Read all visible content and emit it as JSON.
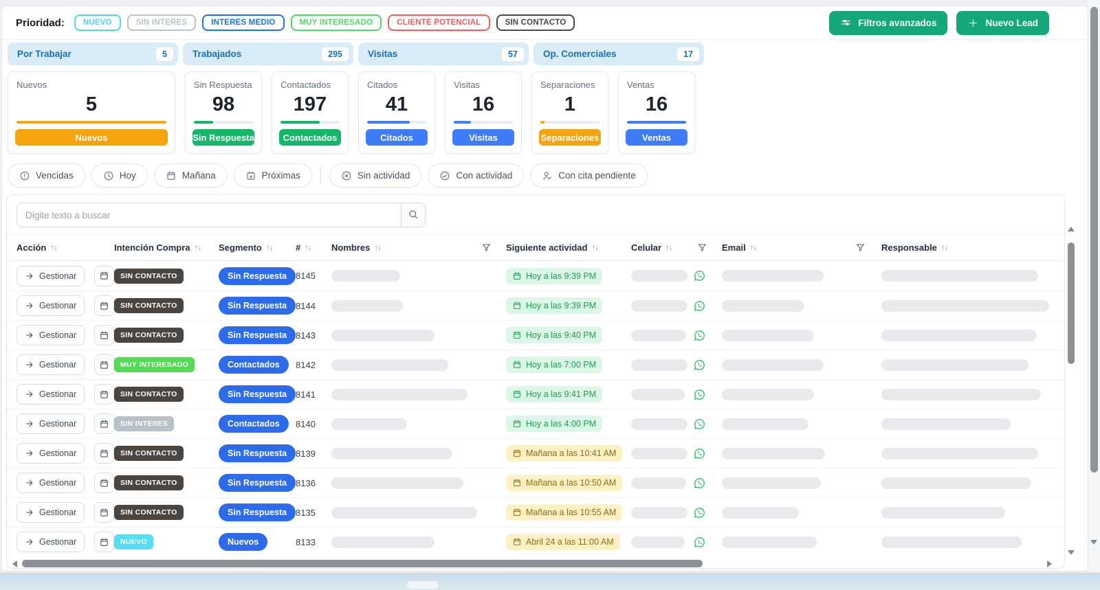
{
  "priority_bar": {
    "label": "Prioridad:",
    "badges": [
      {
        "label": "NUEVO",
        "color": "#4fd6ea"
      },
      {
        "label": "SIN INTERES",
        "color": "#b9c2cc"
      },
      {
        "label": "INTERES MEDIO",
        "color": "#1a73e8"
      },
      {
        "label": "MUY INTERESADO",
        "color": "#4fd964"
      },
      {
        "label": "CLIENTE POTENCIAL",
        "color": "#f45b5b"
      },
      {
        "label": "SIN CONTACTO",
        "color": "#43484d"
      }
    ]
  },
  "actions": {
    "advanced_filters": "Filtros avanzados",
    "new_lead": "Nuevo Lead"
  },
  "tabs": [
    {
      "label": "Por Trabajar",
      "count": "5"
    },
    {
      "label": "Trabajados",
      "count": "295"
    },
    {
      "label": "Visitas",
      "count": "57"
    },
    {
      "label": "Op. Comerciales",
      "count": "17"
    }
  ],
  "cards": [
    {
      "title": "Nuevos",
      "value": "5",
      "button": "Nuevos",
      "color": "#f6a40e",
      "progress": "100%",
      "cls": "card-wide"
    },
    {
      "title": "Sin Respuesta",
      "value": "98",
      "button": "Sin Respuesta",
      "color": "#12b76a",
      "progress": "33%"
    },
    {
      "title": "Contactados",
      "value": "197",
      "button": "Contactados",
      "color": "#12b76a",
      "progress": "66%"
    },
    {
      "title": "Citados",
      "value": "41",
      "button": "Citados",
      "color": "#3d7bf7",
      "progress": "72%"
    },
    {
      "title": "Visitas",
      "value": "16",
      "button": "Visitas",
      "color": "#3d7bf7",
      "progress": "29%"
    },
    {
      "title": "Separaciones",
      "value": "1",
      "button": "Separaciones",
      "color": "#f6a40e",
      "progress": "7%"
    },
    {
      "title": "Ventas",
      "value": "16",
      "button": "Ventas",
      "color": "#3d7bf7",
      "progress": "100%"
    }
  ],
  "chips": [
    {
      "label": "Vencidas",
      "icon": "alert-circle"
    },
    {
      "label": "Hoy",
      "icon": "clock"
    },
    {
      "label": "Mañana",
      "icon": "calendar"
    },
    {
      "label": "Próximas",
      "icon": "calendar-plus",
      "divider": true
    },
    {
      "label": "Sin actividad",
      "icon": "x-circle"
    },
    {
      "label": "Con actividad",
      "icon": "check-circle"
    },
    {
      "label": "Con cita pendiente",
      "icon": "user-check"
    }
  ],
  "search": {
    "placeholder": "Digite texto a buscar"
  },
  "table": {
    "action_label": "Gestionar",
    "columns": [
      {
        "label": "Acción",
        "sort": true
      },
      {
        "label": "Intención Compra",
        "sort": true
      },
      {
        "label": "Segmento",
        "sort": true
      },
      {
        "label": "#",
        "sort": true
      },
      {
        "label": "Nombres",
        "sort": true
      },
      {
        "label": "",
        "filter": true
      },
      {
        "label": "Siguiente actividad",
        "sort": true
      },
      {
        "label": "Celular",
        "sort": true
      },
      {
        "label": "",
        "filter": true
      },
      {
        "label": "Email",
        "sort": true
      },
      {
        "label": "",
        "filter": true
      },
      {
        "label": "Responsable",
        "sort": true
      }
    ],
    "rows": [
      {
        "id": "8145",
        "intencion": "SIN CONTACTO",
        "icls": "i-dark",
        "segmento": "Sin Respuesta",
        "actividad": "Hoy a las 9:39 PM",
        "acls": "act-green",
        "wname": "100px",
        "wcel": "82px",
        "wemail": "148px",
        "wresp": "228px"
      },
      {
        "id": "8144",
        "intencion": "SIN CONTACTO",
        "icls": "i-dark",
        "segmento": "Sin Respuesta",
        "actividad": "Hoy a las 9:39 PM",
        "acls": "act-green",
        "wname": "104px",
        "wcel": "82px",
        "wemail": "120px",
        "wresp": "244px"
      },
      {
        "id": "8143",
        "intencion": "SIN CONTACTO",
        "icls": "i-dark",
        "segmento": "Sin Respuesta",
        "actividad": "Hoy a las 9:40 PM",
        "acls": "act-green",
        "wname": "150px",
        "wcel": "80px",
        "wemail": "134px",
        "wresp": "226px"
      },
      {
        "id": "8142",
        "intencion": "MUY INTERESADO",
        "icls": "i-green",
        "segmento": "Contactados",
        "actividad": "Hoy a las 7:00 PM",
        "acls": "act-green",
        "wname": "170px",
        "wcel": "82px",
        "wemail": "148px",
        "wresp": "214px"
      },
      {
        "id": "8141",
        "intencion": "SIN CONTACTO",
        "icls": "i-dark",
        "segmento": "Sin Respuesta",
        "actividad": "Hoy a las 9:41 PM",
        "acls": "act-green",
        "wname": "198px",
        "wcel": "78px",
        "wemail": "134px",
        "wresp": "232px"
      },
      {
        "id": "8140",
        "intencion": "SIN INTERES",
        "icls": "i-gray",
        "segmento": "Contactados",
        "actividad": "Hoy a las 4:00 PM",
        "acls": "act-green",
        "wname": "110px",
        "wcel": "82px",
        "wemail": "126px",
        "wresp": "188px"
      },
      {
        "id": "8139",
        "intencion": "SIN CONTACTO",
        "icls": "i-dark",
        "segmento": "Sin Respuesta",
        "actividad": "Mañana a las 10:41 AM",
        "acls": "act-yellow",
        "wname": "176px",
        "wcel": "82px",
        "wemail": "150px",
        "wresp": "228px"
      },
      {
        "id": "8136",
        "intencion": "SIN CONTACTO",
        "icls": "i-dark",
        "segmento": "Sin Respuesta",
        "actividad": "Mañana a las 10:50 AM",
        "acls": "act-yellow",
        "wname": "192px",
        "wcel": "80px",
        "wemail": "144px",
        "wresp": "218px"
      },
      {
        "id": "8135",
        "intencion": "SIN CONTACTO",
        "icls": "i-dark",
        "segmento": "Sin Respuesta",
        "actividad": "Mañana a las 10:55 AM",
        "acls": "act-yellow",
        "wname": "232px",
        "wcel": "82px",
        "wemail": "112px",
        "wresp": "180px"
      },
      {
        "id": "8133",
        "intencion": "NUEVO",
        "icls": "i-cyan",
        "segmento": "Nuevos",
        "actividad": "Abril 24 a las 11:00 AM",
        "acls": "act-yellow",
        "wname": "150px",
        "wcel": "78px",
        "wemail": "138px",
        "wresp": "204px"
      }
    ]
  },
  "colors": {
    "button_green": "#14a77c",
    "tab_bg": "#d9ecf8",
    "tab_text": "#1b6fb3",
    "segment_pill_blue": "#2c6cea",
    "whatsapp_green": "#25c35f",
    "activity_green_bg": "#dcf7e8",
    "activity_green_text": "#19a24c",
    "activity_yellow_bg": "#fcf1c4",
    "activity_yellow_text": "#8f6c15",
    "intencion_dark": "#4a4541",
    "intencion_green": "#55d957",
    "intencion_gray": "#b7c1ca",
    "intencion_cyan": "#58dcf2",
    "progress_orange": "#f6a40e",
    "progress_green": "#12b76a",
    "progress_blue": "#3d7bf7"
  }
}
